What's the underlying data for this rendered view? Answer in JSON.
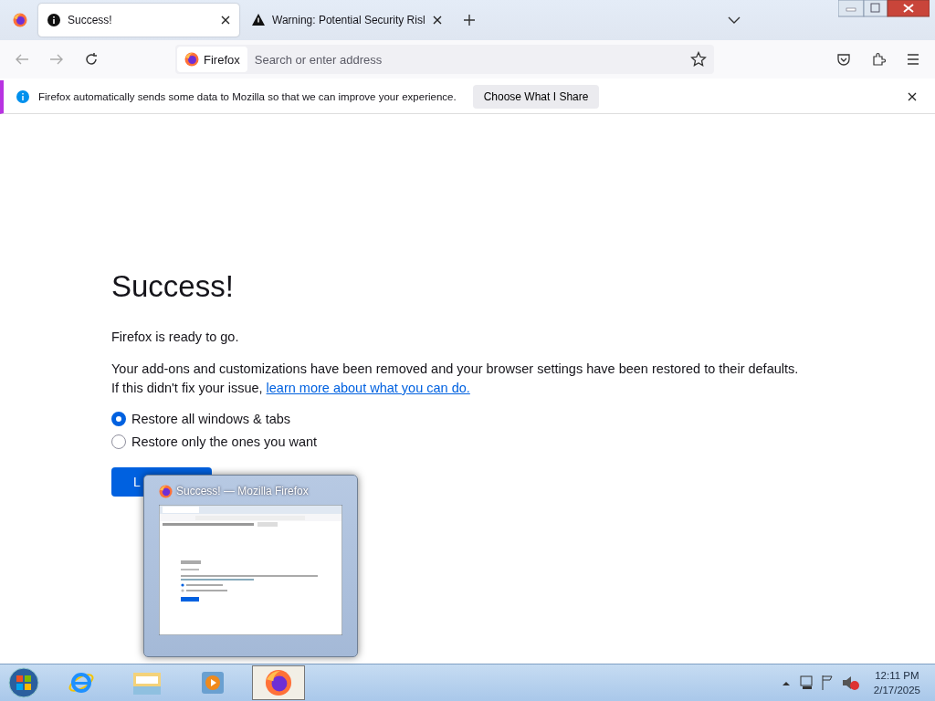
{
  "tabs": [
    {
      "title": "Success!",
      "kind": "info",
      "selected": true
    },
    {
      "title": "Warning: Potential Security Risl",
      "kind": "warning",
      "selected": false
    }
  ],
  "address_bar": {
    "identity": "Firefox",
    "placeholder": "Search or enter address"
  },
  "notification": {
    "message": "Firefox automatically sends some data to Mozilla so that we can improve your experience.",
    "button": "Choose What I Share"
  },
  "page": {
    "heading": "Success!",
    "intro": "Firefox is ready to go.",
    "body": "Your add-ons and customizations have been removed and your browser settings have been restored to their defaults.",
    "help_prefix": "If this didn't fix your issue,",
    "help_link": "learn more about what you can do.",
    "options": [
      {
        "label": "Restore all windows & tabs",
        "selected": true
      },
      {
        "label": "Restore only the ones you want",
        "selected": false
      }
    ],
    "button": "L"
  },
  "preview": {
    "title": "Success! — Mozilla Firefox"
  },
  "taskbar": {
    "time": "12:11 PM",
    "date": "2/17/2025"
  }
}
